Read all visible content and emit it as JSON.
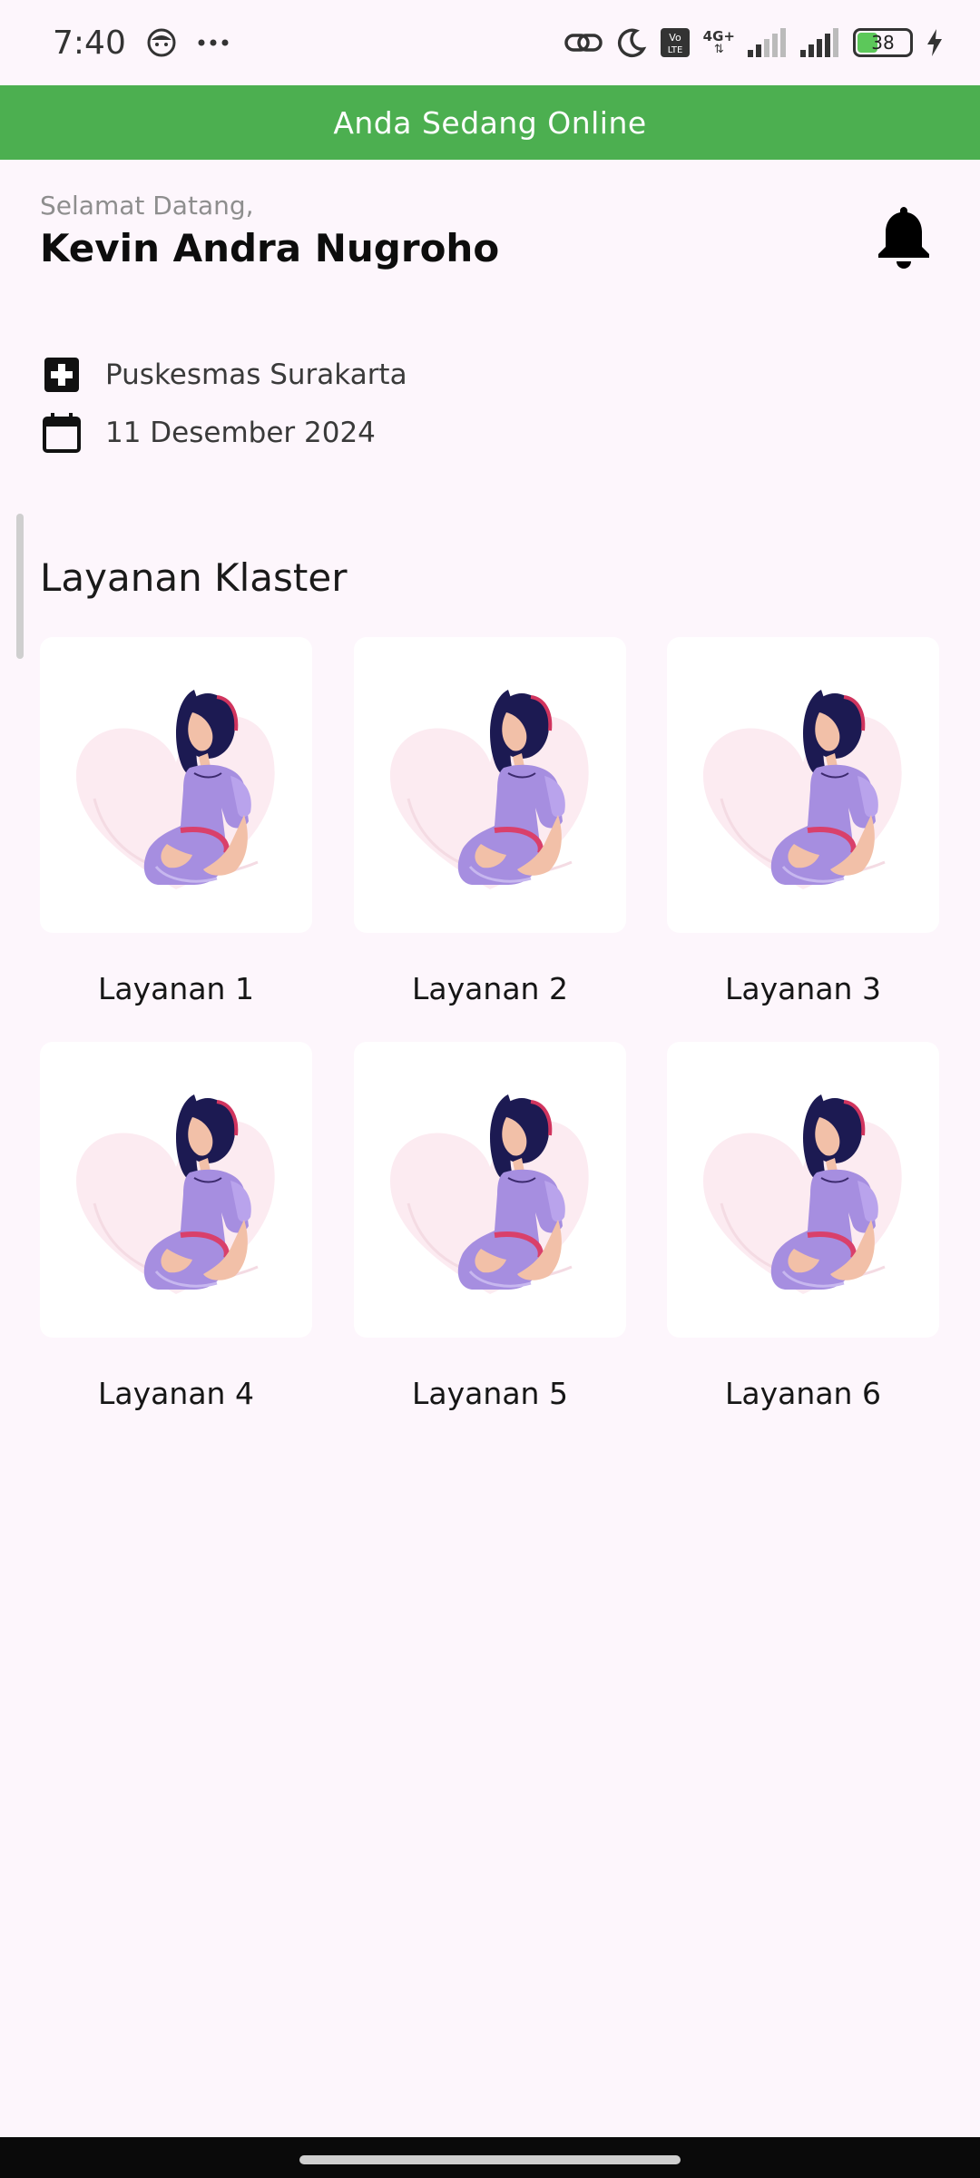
{
  "status_bar": {
    "time": "7:40",
    "battery": "38",
    "network": "4G+",
    "icons": [
      "face-icon",
      "more-dots-icon",
      "link-icon",
      "moon-icon",
      "volte-icon",
      "signal-icon",
      "battery-icon",
      "charging-icon"
    ]
  },
  "banner": {
    "text": "Anda Sedang Online",
    "color": "#4caf50"
  },
  "header": {
    "greeting": "Selamat Datang,",
    "name": "Kevin Andra Nugroho",
    "bell_icon": "bell-icon"
  },
  "info": {
    "facility": "Puskesmas Surakarta",
    "date": "11 Desember 2024",
    "facility_icon": "medical-cross-icon",
    "date_icon": "calendar-icon"
  },
  "section": {
    "title": "Layanan Klaster"
  },
  "services": [
    {
      "label": "Layanan 1"
    },
    {
      "label": "Layanan 2"
    },
    {
      "label": "Layanan 3"
    },
    {
      "label": "Layanan 4"
    },
    {
      "label": "Layanan 5"
    },
    {
      "label": "Layanan 6"
    }
  ]
}
